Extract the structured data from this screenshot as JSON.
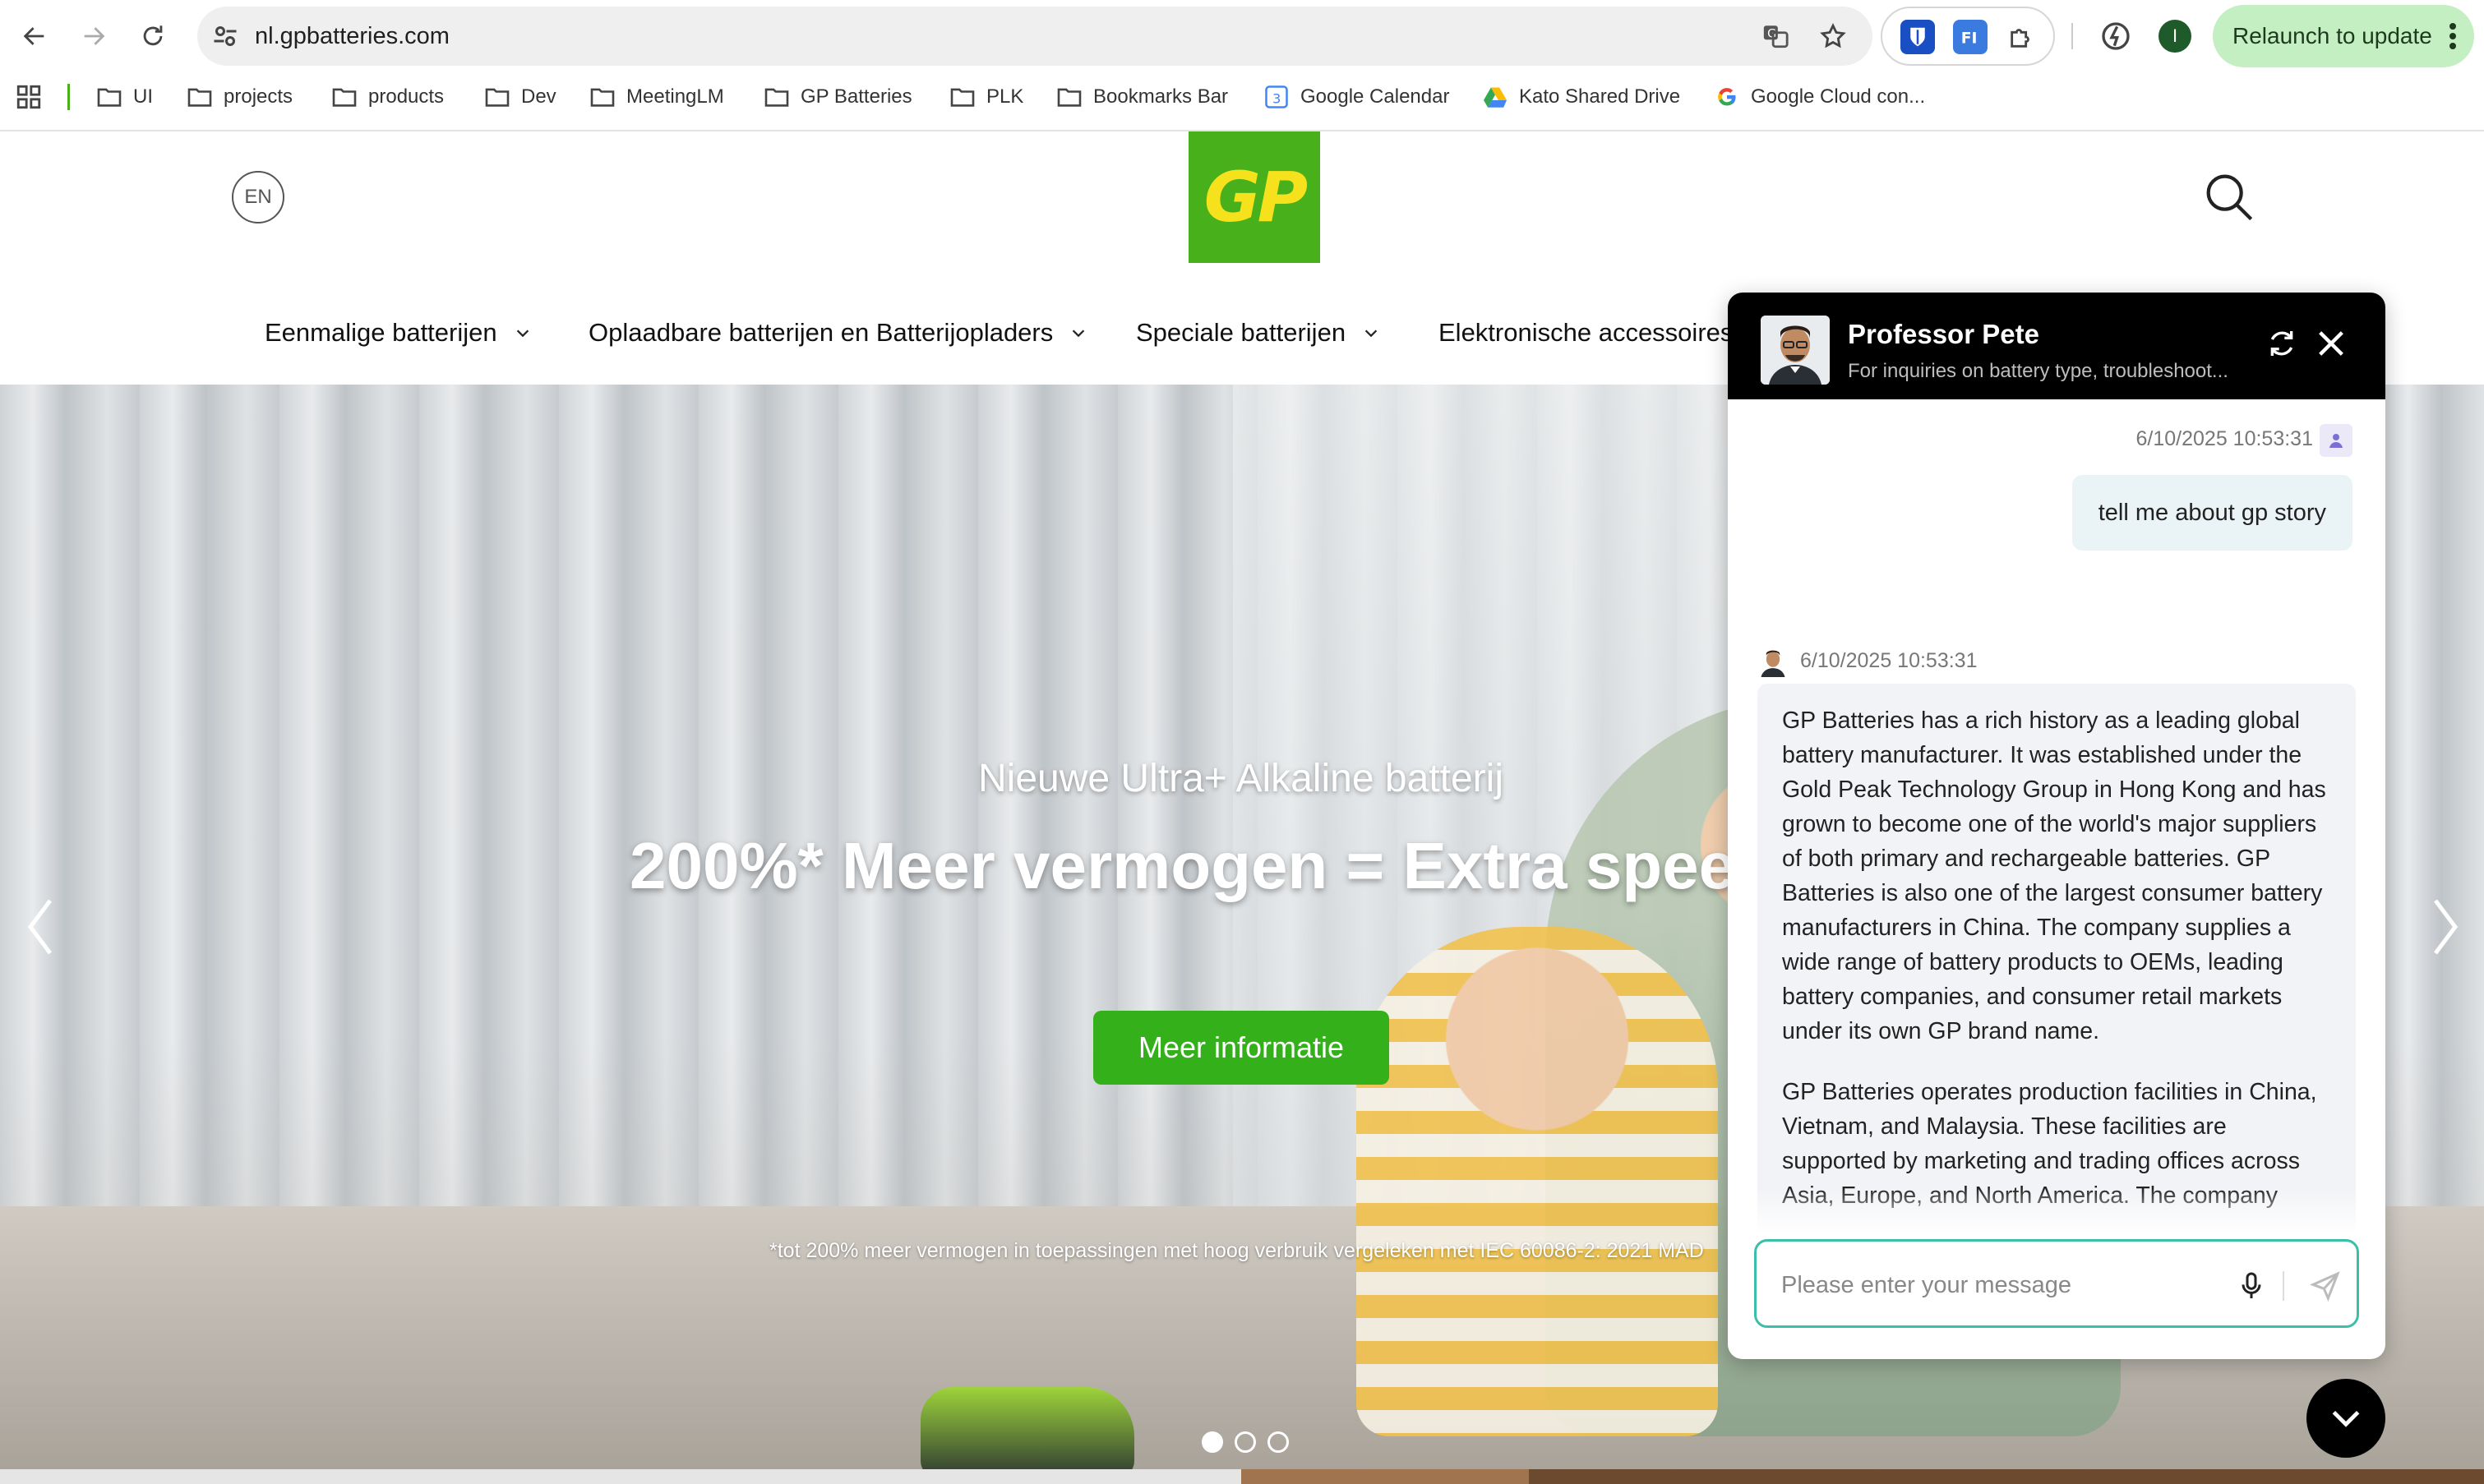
{
  "browser": {
    "url": "nl.gpbatteries.com",
    "relaunch_label": "Relaunch to update",
    "profile_initial": "I",
    "bookmarks": [
      "UI",
      "projects",
      "products",
      "Dev",
      "MeetingLM",
      "GP Batteries",
      "PLK",
      "Bookmarks Bar",
      "Google Calendar",
      "Kato Shared Drive",
      "Google Cloud con..."
    ],
    "calendar_day": "3"
  },
  "site": {
    "lang": "EN",
    "logo_text": "GP",
    "brand_color": "#47b01b",
    "logo_text_color": "#f6e21c",
    "nav": [
      "Eenmalige batterijen",
      "Oplaadbare batterijen en Batterijopladers",
      "Speciale batterijen",
      "Elektronische accessoires"
    ]
  },
  "hero": {
    "subtitle": "Nieuwe Ultra+ Alkaline batterij",
    "title": "200%* Meer vermogen = Extra speelplezier",
    "cta": "Meer informatie",
    "footnote": "*tot 200% meer vermogen in toepassingen met hoog verbruik vergeleken met IEC 60086-2: 2021 MAD",
    "slides": 3,
    "active_slide": 1
  },
  "chat": {
    "name": "Professor Pete",
    "description": "For inquiries on battery type, troubleshoot...",
    "user_time": "6/10/2025 10:53:31",
    "user_message": "tell me about gp story",
    "bot_time": "6/10/2025 10:53:31",
    "bot_paragraphs": [
      "GP Batteries has a rich history as a leading global battery manufacturer. It was established under the Gold Peak Technology Group in Hong Kong and has grown to become one of the world's major suppliers of both primary and rechargeable batteries. GP Batteries is also one of the largest consumer battery manufacturers in China. The company supplies a wide range of battery products to OEMs, leading battery companies, and consumer retail markets under its own GP brand name.",
      "GP Batteries operates production facilities in China, Vietnam, and Malaysia. These facilities are supported by marketing and trading offices across Asia, Europe, and North America. The company"
    ],
    "input_placeholder": "Please enter your message",
    "accent": "#3bbfa8"
  }
}
